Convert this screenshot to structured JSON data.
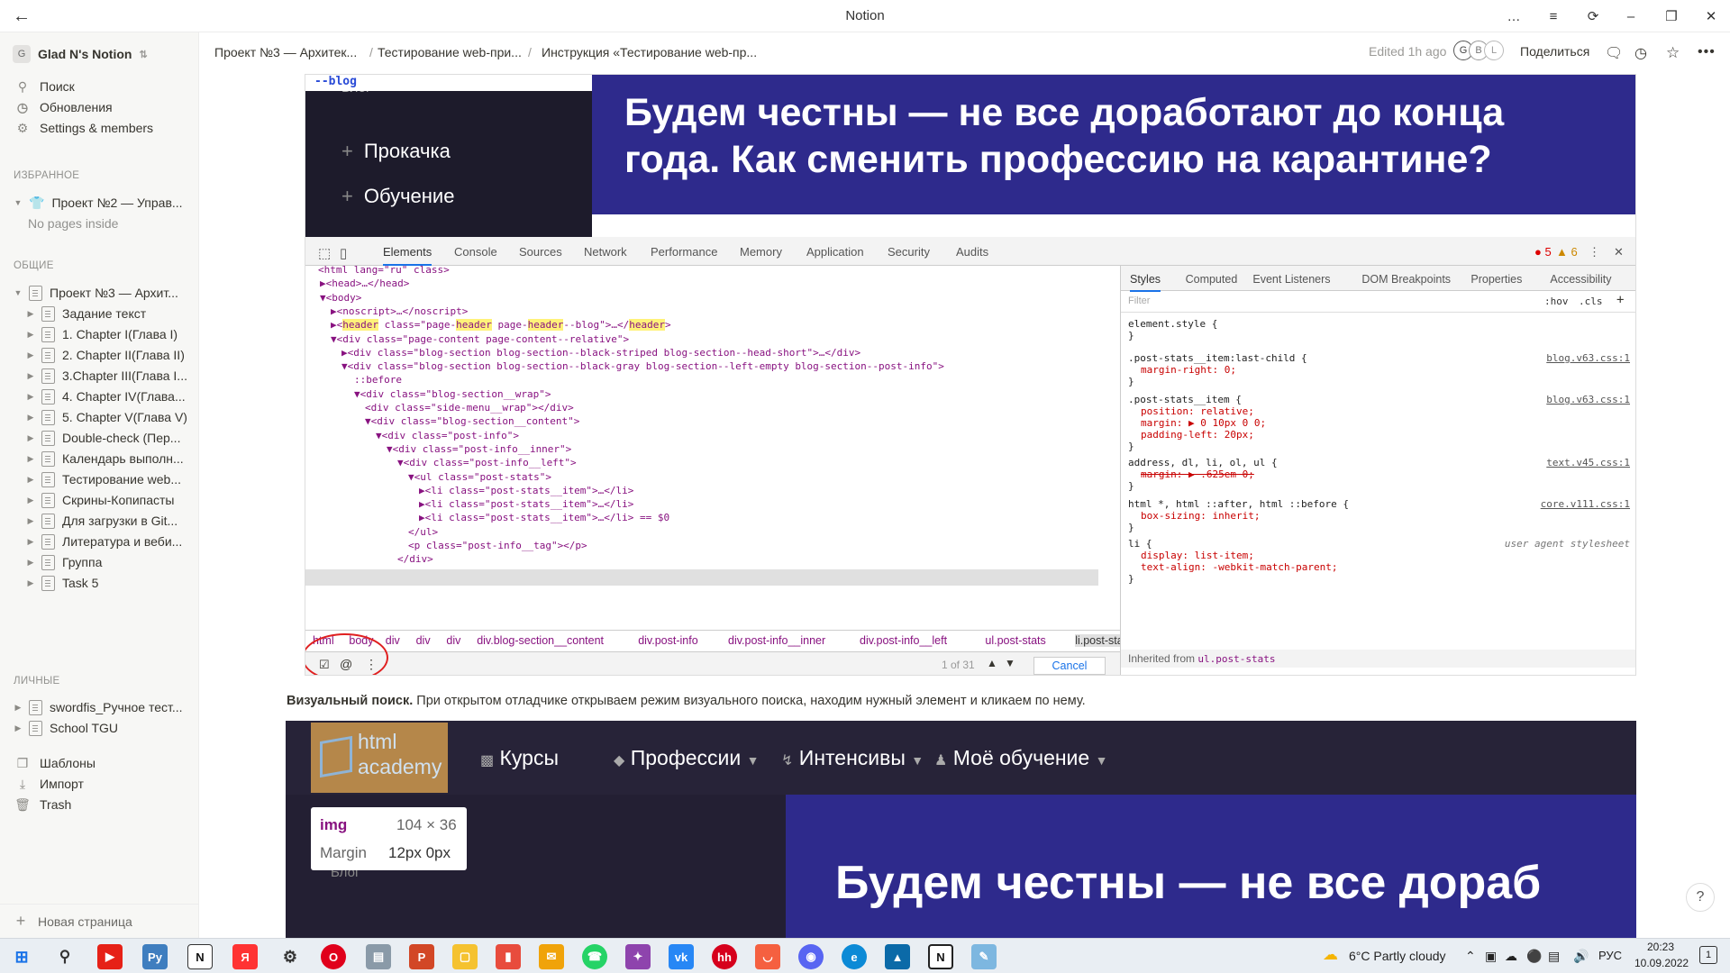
{
  "window": {
    "title": "Notion",
    "controls": [
      "…",
      "≡",
      "⟳",
      "–",
      "❐",
      "✕"
    ]
  },
  "sidebar": {
    "workspace": {
      "avatar": "G",
      "name": "Glad N's Notion"
    },
    "quick": [
      {
        "icon": "search-icon",
        "label": "Поиск"
      },
      {
        "icon": "updates-icon",
        "label": "Обновления"
      },
      {
        "icon": "gear-icon",
        "label": "Settings & members"
      }
    ],
    "favorites_header": "ИЗБРАННОЕ",
    "favorites": [
      {
        "label": "Проект №2 — Управ..."
      }
    ],
    "favorites_empty": "No pages inside",
    "shared_header": "ОБЩИЕ",
    "shared": [
      {
        "label": "Проект №3 — Архит...",
        "level": 0
      },
      {
        "label": "Задание текст",
        "level": 1
      },
      {
        "label": "1. Chapter I(Глава I)",
        "level": 1
      },
      {
        "label": "2. Chapter II(Глава II)",
        "level": 1
      },
      {
        "label": "3.Chapter III(Глава I...",
        "level": 1
      },
      {
        "label": "4. Chapter IV(Глава...",
        "level": 1
      },
      {
        "label": "5. Chapter V(Глава V)",
        "level": 1
      },
      {
        "label": "Double-check (Пер...",
        "level": 1
      },
      {
        "label": "Календарь выполн...",
        "level": 1
      },
      {
        "label": "Тестирование web...",
        "level": 1
      },
      {
        "label": "Скрины-Копипасты",
        "level": 1
      },
      {
        "label": "Для загрузки в Git...",
        "level": 1
      },
      {
        "label": "Литература и веби...",
        "level": 1
      },
      {
        "label": "Группа",
        "level": 1
      },
      {
        "label": "Task 5",
        "level": 1
      }
    ],
    "private_header": "ЛИЧНЫЕ",
    "private": [
      {
        "label": "swordfis_Ручное тест..."
      },
      {
        "label": "School TGU"
      }
    ],
    "bottom": [
      {
        "icon": "templates-icon",
        "label": "Шаблоны"
      },
      {
        "icon": "import-icon",
        "label": "Импорт"
      },
      {
        "icon": "trash-icon",
        "label": "Trash"
      }
    ],
    "new_page": "Новая страница"
  },
  "topbar": {
    "breadcrumbs": [
      "Проект №3 — Архитек...",
      "Тестирование web-при...",
      "Инструкция «Тестирование web-пр..."
    ],
    "edited": "Edited 1h ago",
    "avatars": [
      "G",
      "B",
      "L"
    ],
    "share": "Поделиться"
  },
  "devtools": {
    "banner_title": "Будем честны — не все доработают до конца года. Как сменить профессию на карантине?",
    "blog_tag": "--blog",
    "menu": [
      "Блог",
      "Прокачка",
      "Обучение"
    ],
    "tabs": [
      "Elements",
      "Console",
      "Sources",
      "Network",
      "Performance",
      "Memory",
      "Application",
      "Security",
      "Audits"
    ],
    "errors": "5",
    "warnings": "6",
    "code_lines": [
      "<html lang=\"ru\" class>",
      "▶<head>…</head>",
      "▼<body>",
      "▶<noscript>…</noscript>",
      "▶<header class=\"page-header page-header--blog\">…</header>",
      "▼<div class=\"page-content page-content--relative\">",
      "▶<div class=\"blog-section blog-section--black-striped blog-section--head-short\">…</div>",
      "▼<div class=\"blog-section blog-section--black-gray blog-section--left-empty blog-section--post-info\">",
      "::before",
      "▼<div class=\"blog-section__wrap\">",
      "<div class=\"side-menu__wrap\"></div>",
      "▼<div class=\"blog-section__content\">",
      "▼<div class=\"post-info\">",
      "▼<div class=\"post-info__inner\">",
      "▼<div class=\"post-info__left\">",
      "▼<ul class=\"post-stats\">",
      "▶<li class=\"post-stats__item\">…</li>",
      "▶<li class=\"post-stats__item\">…</li>",
      "▶<li class=\"post-stats__item\">…</li> == $0",
      "</ul>",
      "<p class=\"post-info__tag\"></p>",
      "</div>"
    ],
    "styles_tabs": [
      "Styles",
      "Computed",
      "Event Listeners",
      "DOM Breakpoints",
      "Properties",
      "Accessibility"
    ],
    "filter_placeholder": "Filter",
    "hov": ":hov",
    "cls": ".cls",
    "style_rules": [
      {
        "sel": "element.style {",
        "props": [],
        "src": ""
      },
      {
        "sel": ".post-stats__item:last-child {",
        "props": [
          "margin-right: 0;"
        ],
        "src": "blog.v63.css:1"
      },
      {
        "sel": ".post-stats__item {",
        "props": [
          "position: relative;",
          "margin: ▶ 0 10px 0 0;",
          "padding-left: 20px;"
        ],
        "src": "blog.v63.css:1"
      },
      {
        "sel": "address, dl, li, ol, ul {",
        "props": [
          "margin: ▶ .625em 0;"
        ],
        "src": "text.v45.css:1"
      },
      {
        "sel": "html *, html ::after, html ::before {",
        "props": [
          "box-sizing: inherit;"
        ],
        "src": "core.v111.css:1"
      },
      {
        "sel": "li {",
        "props": [
          "display: list-item;",
          "text-align: -webkit-match-parent;"
        ],
        "src": "user agent stylesheet"
      }
    ],
    "inherited_label": "Inherited from",
    "inherited_from": "ul.post-stats",
    "dom_path": [
      "html",
      "body",
      "div",
      "div",
      "div",
      "div.blog-section__content",
      "div.post-info",
      "div.post-info__inner",
      "div.post-info__left",
      "ul.post-stats",
      "li.post-stats__item"
    ],
    "search_count": "1 of 31",
    "cancel": "Cancel"
  },
  "caption": {
    "bold": "Визуальный поиск.",
    "text": " При открытом отладчике открываем режим визуального поиска, находим нужный элемент и кликаем по нему."
  },
  "screenshot2": {
    "logo_top": "html",
    "logo_bottom": "academy",
    "nav": [
      "Курсы",
      "Профессии",
      "Интенсивы",
      "Моё обучение"
    ],
    "tooltip_tag": "img",
    "tooltip_size": "104 × 36",
    "tooltip_label": "Margin",
    "tooltip_value": "12px 0px",
    "banner_title": "Будем честны — не все дораб",
    "blog": "Блог"
  },
  "help": "?",
  "taskbar": {
    "weather": "6°C  Partly cloudy",
    "lang": "РУС",
    "time": "20:23",
    "date": "10.09.2022",
    "notif": "1"
  }
}
